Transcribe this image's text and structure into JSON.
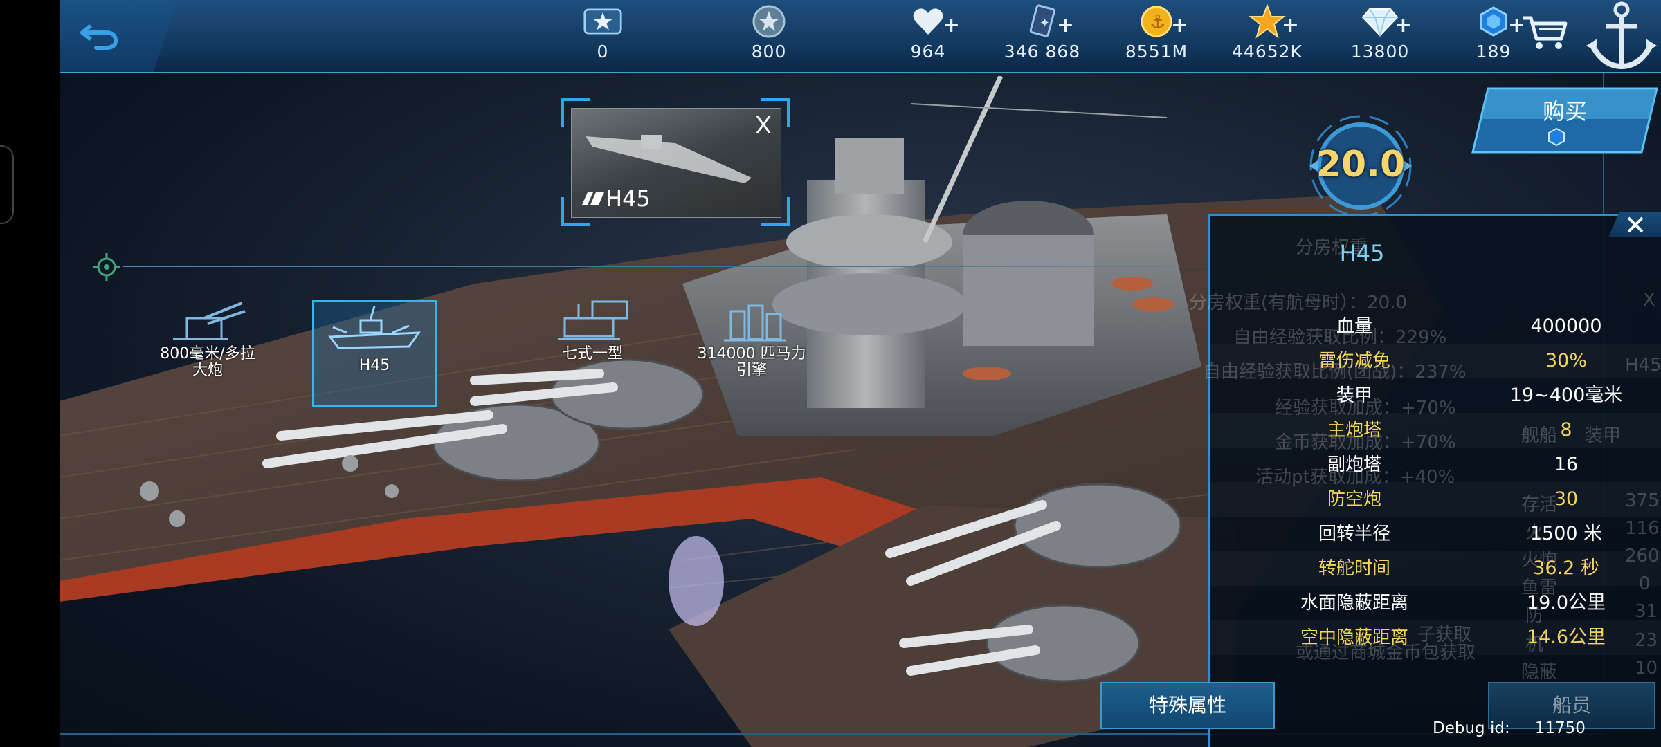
{
  "topbar": {
    "resources": [
      {
        "icon": "rank-star-icon",
        "value": "0",
        "has_plus": false
      },
      {
        "icon": "medal-icon",
        "value": "800",
        "has_plus": false
      },
      {
        "icon": "heart-icon",
        "value": "964",
        "has_plus": true
      },
      {
        "icon": "card-icon",
        "value": "346 868",
        "has_plus": true
      },
      {
        "icon": "gold-coin-icon",
        "value": "8551M",
        "has_plus": true
      },
      {
        "icon": "star-icon",
        "value": "44652K",
        "has_plus": true
      },
      {
        "icon": "diamond-icon",
        "value": "13800",
        "has_plus": true
      },
      {
        "icon": "blue-crystal-icon",
        "value": "189",
        "has_plus": true
      }
    ]
  },
  "selected_card": {
    "name": "H45",
    "close": "X"
  },
  "modules": [
    {
      "label": "800毫米/多拉\n大炮",
      "selected": false
    },
    {
      "label": "H45",
      "selected": true
    },
    {
      "label": "七式一型",
      "selected": false
    },
    {
      "label": "314000 匹马力\n引擎",
      "selected": false
    }
  ],
  "score": "20.0",
  "buy": {
    "label": "购买"
  },
  "panel": {
    "title": "H45",
    "ghost_lines": [
      "分房权重",
      "分房权重(有航母时）：20.0",
      "自由经验获取比例：229%",
      "自由经验获取比例(团战)：237%",
      "经验获取加成：+70%",
      "金币获取加成：+70%",
      "活动pt获取加成：+40%",
      "子获取",
      "或通过商城金币包获取"
    ],
    "stats": [
      {
        "label": "血量",
        "value": "400000",
        "color": "white"
      },
      {
        "label": "雷伤减免",
        "value": "30%",
        "color": "yellow"
      },
      {
        "label": "装甲",
        "value": "19~400毫米",
        "color": "white"
      },
      {
        "label": "主炮塔",
        "value": "8",
        "color": "yellow"
      },
      {
        "label": "副炮塔",
        "value": "16",
        "color": "white"
      },
      {
        "label": "防空炮",
        "value": "30",
        "color": "yellow"
      },
      {
        "label": "回转半径",
        "value": "1500 米",
        "color": "white"
      },
      {
        "label": "转舵时间",
        "value": "36.2 秒",
        "color": "yellow"
      },
      {
        "label": "水面隐蔽距离",
        "value": "19.0公里",
        "color": "white"
      },
      {
        "label": "空中隐蔽距离",
        "value": "14.6公里",
        "color": "yellow"
      }
    ],
    "right_ghost": [
      "舰船",
      "装甲",
      "存活",
      "375",
      "火",
      "116",
      "火炮",
      "260",
      "鱼雷",
      "0",
      "防",
      "31",
      "机",
      "23",
      "隐蔽",
      "10",
      "X",
      "H45"
    ]
  },
  "bottom": {
    "special_label": "特殊属性",
    "crew_label": "船员",
    "debug_label": "Debug id:",
    "debug_value": "11750"
  },
  "colors": {
    "accent": "#2ea8ea",
    "stat_yellow": "#f5d65b",
    "title_blue": "#7fd3f7"
  }
}
